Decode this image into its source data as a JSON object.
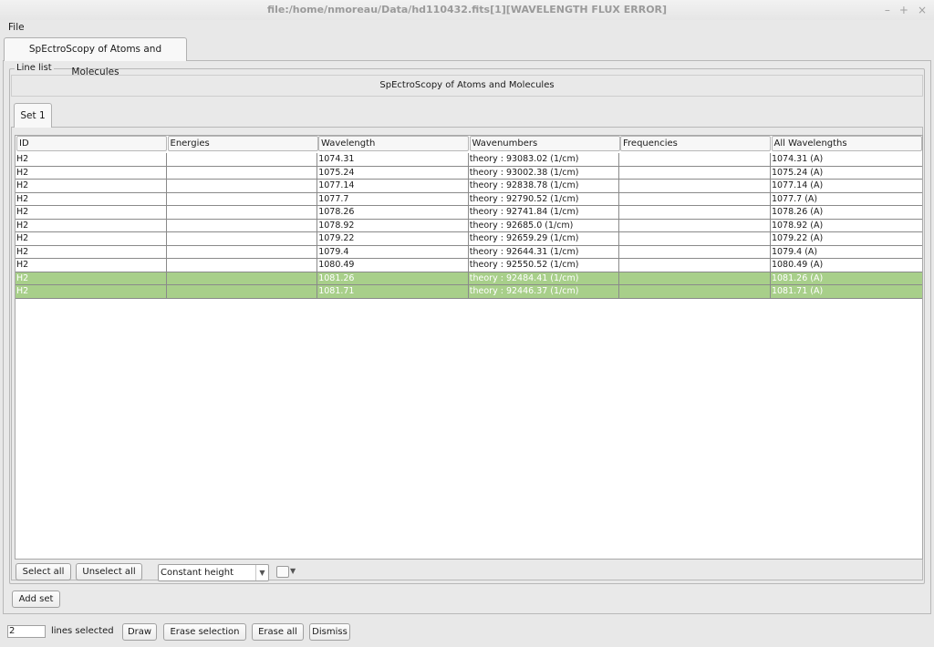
{
  "window": {
    "title": "file:/home/nmoreau/Data/hd110432.fits[1][WAVELENGTH FLUX ERROR]",
    "controls": [
      "–",
      "+",
      "×"
    ]
  },
  "menu": {
    "file": "File"
  },
  "outer_tab": {
    "label": "SpEctroScopy of Atoms and Molecules"
  },
  "line_list": {
    "legend": "Line list",
    "subtitle": "SpEctroScopy of Atoms and Molecules",
    "set_tab": "Set 1",
    "columns": [
      "ID",
      "Energies",
      "Wavelength",
      "Wavenumbers",
      "Frequencies",
      "All Wavelengths"
    ],
    "rows": [
      {
        "id": "H2",
        "energies": "",
        "wavelength": "1074.31",
        "wavenumbers": "theory : 93083.02 (1/cm)",
        "frequencies": "",
        "all_wavelengths": "1074.31 (A)",
        "selected": false
      },
      {
        "id": "H2",
        "energies": "",
        "wavelength": "1075.24",
        "wavenumbers": "theory : 93002.38 (1/cm)",
        "frequencies": "",
        "all_wavelengths": "1075.24 (A)",
        "selected": false
      },
      {
        "id": "H2",
        "energies": "",
        "wavelength": "1077.14",
        "wavenumbers": "theory : 92838.78 (1/cm)",
        "frequencies": "",
        "all_wavelengths": "1077.14 (A)",
        "selected": false
      },
      {
        "id": "H2",
        "energies": "",
        "wavelength": "1077.7",
        "wavenumbers": "theory : 92790.52 (1/cm)",
        "frequencies": "",
        "all_wavelengths": "1077.7 (A)",
        "selected": false
      },
      {
        "id": "H2",
        "energies": "",
        "wavelength": "1078.26",
        "wavenumbers": "theory : 92741.84 (1/cm)",
        "frequencies": "",
        "all_wavelengths": "1078.26 (A)",
        "selected": false
      },
      {
        "id": "H2",
        "energies": "",
        "wavelength": "1078.92",
        "wavenumbers": "theory : 92685.0 (1/cm)",
        "frequencies": "",
        "all_wavelengths": "1078.92 (A)",
        "selected": false
      },
      {
        "id": "H2",
        "energies": "",
        "wavelength": "1079.22",
        "wavenumbers": "theory : 92659.29 (1/cm)",
        "frequencies": "",
        "all_wavelengths": "1079.22 (A)",
        "selected": false
      },
      {
        "id": "H2",
        "energies": "",
        "wavelength": "1079.4",
        "wavenumbers": "theory : 92644.31 (1/cm)",
        "frequencies": "",
        "all_wavelengths": "1079.4 (A)",
        "selected": false
      },
      {
        "id": "H2",
        "energies": "",
        "wavelength": "1080.49",
        "wavenumbers": "theory : 92550.52 (1/cm)",
        "frequencies": "",
        "all_wavelengths": "1080.49 (A)",
        "selected": false
      },
      {
        "id": "H2",
        "energies": "",
        "wavelength": "1081.26",
        "wavenumbers": "theory : 92484.41 (1/cm)",
        "frequencies": "",
        "all_wavelengths": "1081.26 (A)",
        "selected": true
      },
      {
        "id": "H2",
        "energies": "",
        "wavelength": "1081.71",
        "wavenumbers": "theory : 92446.37 (1/cm)",
        "frequencies": "",
        "all_wavelengths": "1081.71 (A)",
        "selected": true
      }
    ],
    "selected_row_color": "#a8cf8a",
    "select_all": "Select all",
    "unselect_all": "Unselect all",
    "height_mode": "Constant height"
  },
  "add_set": "Add set",
  "status": {
    "count": "2",
    "label": "lines selected",
    "draw": "Draw",
    "erase_selection": "Erase selection",
    "erase_all": "Erase all",
    "dismiss": "Dismiss"
  }
}
